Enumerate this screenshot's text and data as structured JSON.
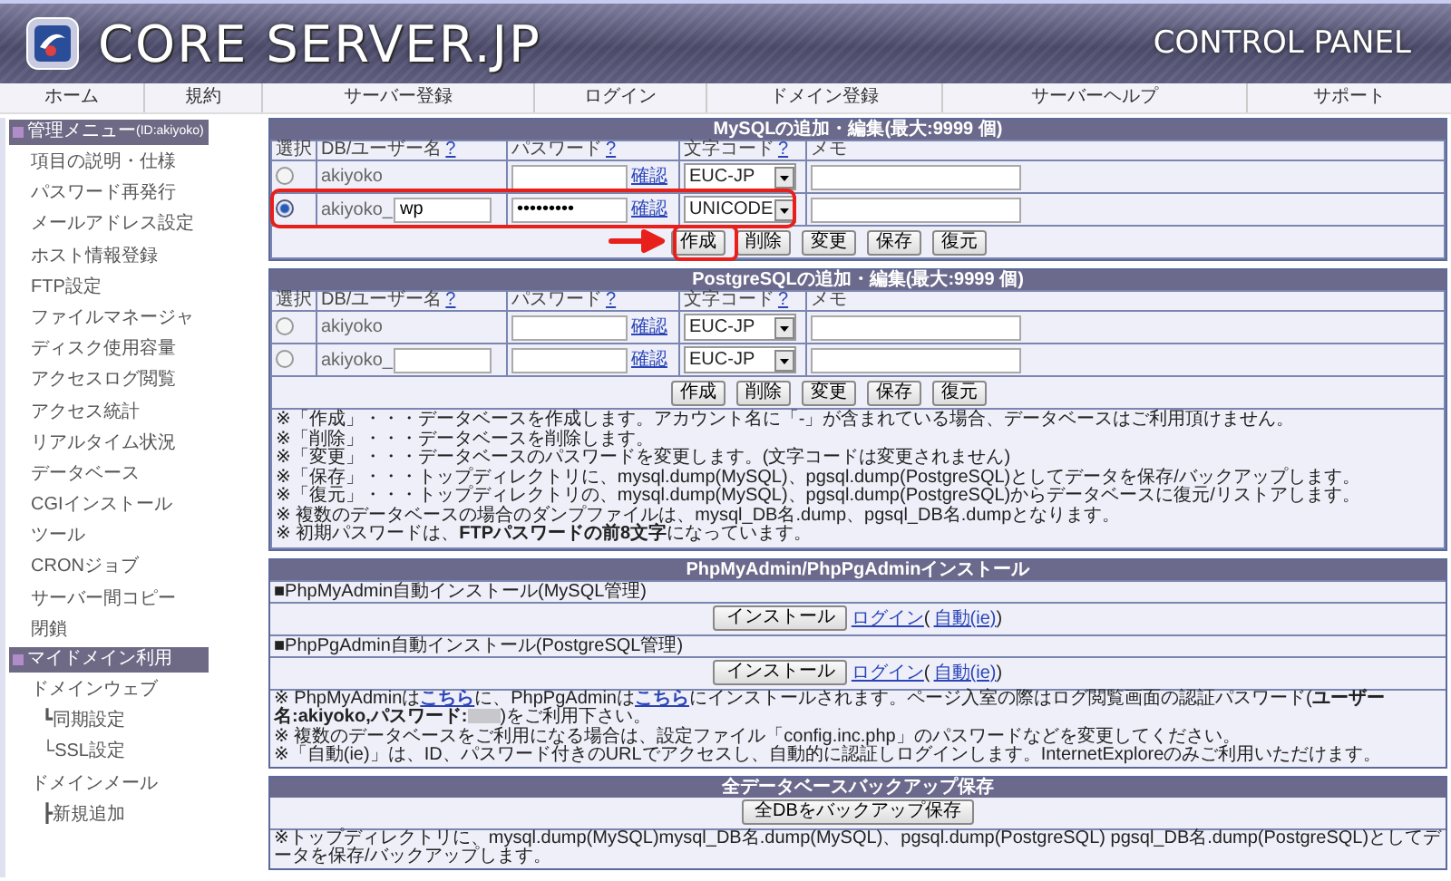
{
  "header": {
    "logo_text": "CORE SERVER.JP",
    "subtitle": "CONTROL PANEL"
  },
  "nav": [
    {
      "label": "ホーム"
    },
    {
      "label": "規約"
    },
    {
      "label": "サーバー登録"
    },
    {
      "label": "ログイン"
    },
    {
      "label": "ドメイン登録"
    },
    {
      "label": "サーバーヘルプ"
    },
    {
      "label": "サポート"
    }
  ],
  "sidebar": [
    {
      "title": "管理メニュー",
      "id_label": "(ID:akiyoko)",
      "items": [
        {
          "label": "項目の説明・仕様"
        },
        {
          "label": "パスワード再発行"
        },
        {
          "label": "メールアドレス設定"
        },
        {
          "label": "ホスト情報登録"
        },
        {
          "label": "FTP設定"
        },
        {
          "label": "ファイルマネージャ"
        },
        {
          "label": "ディスク使用容量"
        },
        {
          "label": "アクセスログ閲覧"
        },
        {
          "label": "アクセス統計"
        },
        {
          "label": "リアルタイム状況"
        },
        {
          "label": "データベース"
        },
        {
          "label": "CGIインストール"
        },
        {
          "label": "ツール"
        },
        {
          "label": "CRONジョブ"
        },
        {
          "label": "サーバー間コピー"
        },
        {
          "label": "閉鎖"
        }
      ]
    },
    {
      "title": "マイドメイン利用",
      "items": [
        {
          "label": "ドメインウェブ",
          "children": [
            {
              "label": "┗同期設定"
            },
            {
              "label": "└SSL設定"
            }
          ]
        },
        {
          "label": "ドメインメール",
          "children": [
            {
              "label": "┣新規追加"
            }
          ]
        }
      ]
    }
  ],
  "databases": [
    {
      "title": "MySQLの追加・編集(最大:9999 個)",
      "columns": [
        {
          "label": "選択"
        },
        {
          "label": "DB/ユーザー名",
          "help": "?"
        },
        {
          "label": "パスワード",
          "help": "?"
        },
        {
          "label": "文字コード",
          "help": "?"
        },
        {
          "label": "メモ"
        }
      ],
      "rows": [
        {
          "kind": "existing",
          "selected": false,
          "name": "akiyoko",
          "confirm": "確認",
          "charset": "EUC-JP"
        },
        {
          "kind": "new",
          "selected": true,
          "name": "akiyoko_",
          "name_value": "wp",
          "password": "•••••••••",
          "confirm": "確認",
          "charset": "UNICODE"
        }
      ],
      "buttons": [
        "作成",
        "削除",
        "変更",
        "保存",
        "復元"
      ]
    },
    {
      "title": "PostgreSQLの追加・編集(最大:9999 個)",
      "columns": [
        {
          "label": "選択"
        },
        {
          "label": "DB/ユーザー名",
          "help": "?"
        },
        {
          "label": "パスワード",
          "help": "?"
        },
        {
          "label": "文字コード",
          "help": "?"
        },
        {
          "label": "メモ"
        }
      ],
      "rows": [
        {
          "kind": "existing",
          "selected": false,
          "name": "akiyoko",
          "confirm": "確認",
          "charset": "EUC-JP"
        },
        {
          "kind": "new",
          "selected": false,
          "name": "akiyoko_",
          "confirm": "確認",
          "charset": "EUC-JP"
        }
      ],
      "buttons": [
        "作成",
        "削除",
        "変更",
        "保存",
        "復元"
      ],
      "notes": [
        "※「作成」・・・データベースを作成します。アカウント名に「-」が含まれている場合、データベースはご利用頂けません。",
        "※「削除」・・・データベースを削除します。",
        "※「変更」・・・データベースのパスワードを変更します。(文字コードは変更されません)",
        "※「保存」・・・トップディレクトリに、mysql.dump(MySQL)、pgsql.dump(PostgreSQL)としてデータを保存/バックアップします。",
        "※「復元」・・・トップディレクトリの、mysql.dump(MySQL)、pgsql.dump(PostgreSQL)からデータベースに復元/リストアします。",
        "※ 複数のデータベースの場合のダンプファイルは、mysql_DB名.dump、pgsql_DB名.dumpとなります。",
        "※ 初期パスワードは、**FTPパスワードの前8文字**になっています。"
      ]
    }
  ],
  "install": {
    "title": "PhpMyAdmin/PhpPgAdminインストール",
    "items": [
      {
        "label": "■PhpMyAdmin自動インストール(MySQL管理)",
        "button": "インストール",
        "login": "ログイン",
        "paren_open": "(",
        "auto": "自動(ie)",
        "paren_close": ")"
      },
      {
        "label": "■PhpPgAdmin自動インストール(PostgreSQL管理)",
        "button": "インストール",
        "login": "ログイン",
        "paren_open": "(",
        "auto": "自動(ie)",
        "paren_close": ")"
      }
    ],
    "notes": [
      [
        {
          "kind": "text",
          "text": "※ PhpMyAdminは"
        },
        {
          "kind": "link",
          "text": "こちら"
        },
        {
          "kind": "text",
          "text": "に、PhpPgAdminは"
        },
        {
          "kind": "link",
          "text": "こちら"
        },
        {
          "kind": "text",
          "text": "にインストールされます。ページ入室の際はログ閲覧画面の認証パスワード(**ユーザー名:akiyoko,パスワード:**"
        },
        {
          "kind": "redacted"
        },
        {
          "kind": "text",
          "text": ")をご利用下さい。"
        }
      ],
      [
        {
          "kind": "text",
          "text": "※ 複数のデータベースをご利用になる場合は、設定ファイル「config.inc.php」のパスワードなどを変更してください。"
        }
      ],
      [
        {
          "kind": "text",
          "text": "※「自動(ie)」は、ID、パスワード付きのURLでアクセスし、自動的に認証しログインします。InternetExploreのみご利用いただけます。"
        }
      ]
    ]
  },
  "backup": {
    "title": "全データベースバックアップ保存",
    "button": "全DBをバックアップ保存",
    "note": "※トップディレクトリに、mysql.dump(MySQL)mysql_DB名.dump(MySQL)、pgsql.dump(PostgreSQL) pgsql_DB名.dump(PostgreSQL)としてデータを保存/バックアップします。"
  }
}
